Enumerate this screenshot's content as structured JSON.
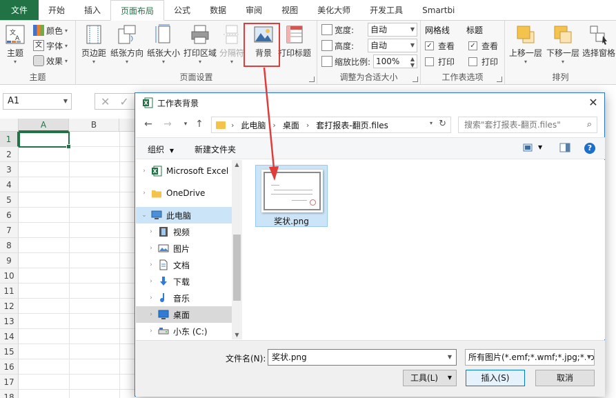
{
  "ribbon": {
    "tabs": [
      "文件",
      "开始",
      "插入",
      "页面布局",
      "公式",
      "数据",
      "审阅",
      "视图",
      "美化大师",
      "开发工具",
      "Smartbi"
    ],
    "theme_group": {
      "label": "主题",
      "theme_btn": "主题",
      "colors": "颜色",
      "fonts": "字体",
      "effects": "效果"
    },
    "page_setup_group": {
      "label": "页面设置",
      "margins": "页边距",
      "orientation": "纸张方向",
      "size": "纸张大小",
      "print_area": "打印区域",
      "breaks": "分隔符",
      "background": "背景",
      "print_titles": "打印标题"
    },
    "scale_group": {
      "label": "调整为合适大小",
      "width_label": "宽度:",
      "width_value": "自动",
      "height_label": "高度:",
      "height_value": "自动",
      "scale_label": "缩放比例:",
      "scale_value": "100%"
    },
    "sheet_options_group": {
      "label": "工作表选项",
      "gridlines_title": "网格线",
      "gridlines_view": "查看",
      "gridlines_print": "打印",
      "headings_title": "标题",
      "headings_view": "查看",
      "headings_print": "打印"
    },
    "arrange_group": {
      "label": "排列",
      "bring_forward": "上移一层",
      "send_backward": "下移一层",
      "selection_pane": "选择窗格"
    }
  },
  "formula_bar": {
    "name_box": "A1"
  },
  "grid": {
    "columns": [
      "A",
      "B"
    ],
    "rows": [
      "1",
      "2",
      "3",
      "4",
      "5",
      "6",
      "7",
      "8",
      "9",
      "10",
      "11",
      "12",
      "13",
      "14",
      "15",
      "16",
      "17",
      "18"
    ]
  },
  "dialog": {
    "title": "工作表背景",
    "breadcrumb": [
      "此电脑",
      "桌面",
      "套打报表-翻页.files"
    ],
    "search_placeholder": "搜索\"套打报表-翻页.files\"",
    "organize": "组织",
    "new_folder": "新建文件夹",
    "nav_items": [
      {
        "label": "Microsoft Excel",
        "icon": "excel-icon"
      },
      {
        "label": "OneDrive",
        "icon": "folder-icon"
      },
      {
        "label": "此电脑",
        "icon": "computer-icon"
      },
      {
        "label": "视频",
        "icon": "video-icon"
      },
      {
        "label": "图片",
        "icon": "picture-icon"
      },
      {
        "label": "文档",
        "icon": "document-icon"
      },
      {
        "label": "下载",
        "icon": "download-icon"
      },
      {
        "label": "音乐",
        "icon": "music-icon"
      },
      {
        "label": "桌面",
        "icon": "desktop-icon"
      },
      {
        "label": "小东 (C:)",
        "icon": "drive-icon"
      }
    ],
    "file": {
      "name": "奖状.png"
    },
    "filename_label": "文件名(N):",
    "filename_value": "奖状.png",
    "filetype_value": "所有图片(*.emf;*.wmf;*.jpg;*.jp",
    "tools": "工具(L)",
    "insert": "插入(S)",
    "cancel": "取消"
  },
  "colors": {
    "excel_green": "#217346",
    "highlight_red": "#e03c3c",
    "selection_blue": "#cce4f7"
  }
}
